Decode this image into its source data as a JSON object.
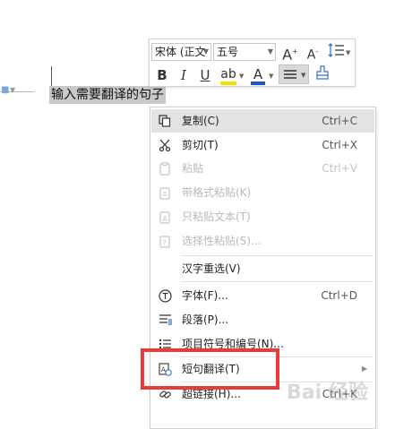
{
  "document": {
    "selected_text": "输入需要翻译的句子"
  },
  "toolbar": {
    "font_name": "宋体 (正文",
    "font_size": "五号",
    "grow_font": "A",
    "shrink_font": "A",
    "bold": "B",
    "italic": "I",
    "underline": "U",
    "highlight": "ab",
    "font_color": "A",
    "highlight_color": "#f5e000",
    "font_color_value": "#1f4fd8"
  },
  "menu": {
    "copy": {
      "label": "复制(C)",
      "shortcut": "Ctrl+C"
    },
    "cut": {
      "label": "剪切(T)",
      "shortcut": "Ctrl+X"
    },
    "paste": {
      "label": "粘贴",
      "shortcut": "Ctrl+V"
    },
    "paste_format": {
      "label": "带格式粘贴(K)"
    },
    "paste_text": {
      "label": "只粘贴文本(T)"
    },
    "paste_special": {
      "label": "选择性粘贴(S)..."
    },
    "reselect": {
      "label": "汉字重选(V)"
    },
    "font": {
      "label": "字体(F)...",
      "shortcut": "Ctrl+D"
    },
    "paragraph": {
      "label": "段落(P)..."
    },
    "bullets": {
      "label": "项目符号和编号(N)..."
    },
    "translate": {
      "label": "短句翻译(T)"
    },
    "hyperlink": {
      "label": "超链接(H)...",
      "shortcut": "Ctrl+K"
    }
  },
  "watermark": "Bai 经验",
  "colors": {
    "highlight_box": "#ea3a3a",
    "menu_hover": "#e3e3e3",
    "disabled_text": "#b9b9b9"
  }
}
